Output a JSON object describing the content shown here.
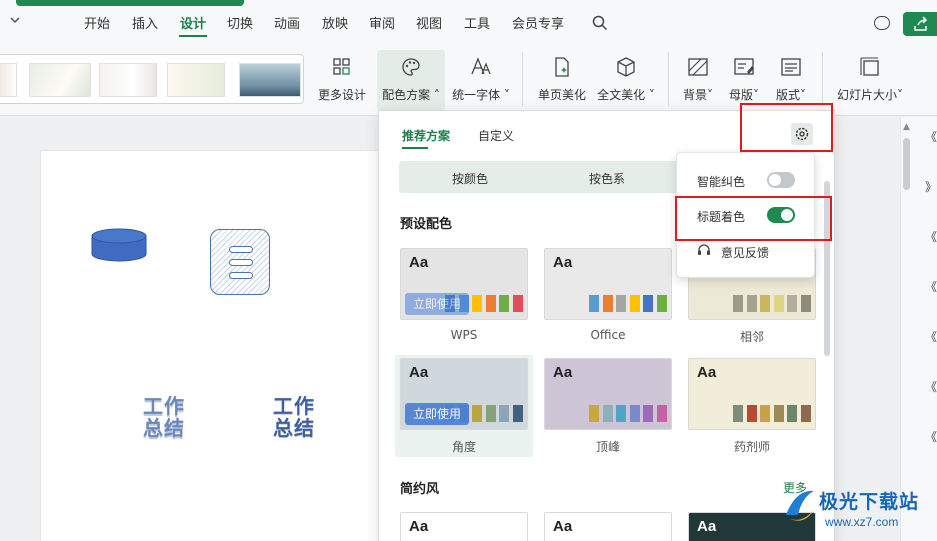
{
  "menu": {
    "tabs": [
      "开始",
      "插入",
      "设计",
      "切换",
      "动画",
      "放映",
      "审阅",
      "视图",
      "工具",
      "会员专享"
    ],
    "active": "设计"
  },
  "ribbon": {
    "more_design": "更多设计",
    "color_scheme": "配色方案",
    "unify_font": "统一字体",
    "page_beautify": "单页美化",
    "full_beautify": "全文美化",
    "background": "背景",
    "master": "母版",
    "layout": "版式",
    "slide_size": "幻灯片大小"
  },
  "slide": {
    "wordart1": "工作总结",
    "wordart2": "工作总结"
  },
  "panel": {
    "tab_recommended": "推荐方案",
    "tab_custom": "自定义",
    "seg_by_color": "按颜色",
    "seg_by_series": "按色系",
    "preset_title": "预设配色",
    "simple_title": "简约风",
    "more": "更多",
    "use_now": "立即使用",
    "aa": "Aa",
    "cards": [
      {
        "name": "WPS",
        "bg": "#e4e4e4",
        "colors": [
          "#4472c4",
          "#5b9bd5",
          "#ffc000",
          "#ed7d31",
          "#70ad47",
          "#e84c5a"
        ]
      },
      {
        "name": "Office",
        "bg": "#e9e9e9",
        "colors": [
          "#5b9bd5",
          "#ed7d31",
          "#a5a5a5",
          "#ffc000",
          "#4472c4",
          "#70ad47"
        ]
      },
      {
        "name": "相邻",
        "bg": "#ece9d6",
        "colors": [
          "#9c9a88",
          "#a6a38a",
          "#c9b660",
          "#dcd585",
          "#b4ae9c",
          "#8e8b79"
        ]
      },
      {
        "name": "角度",
        "bg": "#cfd8dc",
        "colors": [
          "#7e97b3",
          "#6f8aa6",
          "#b6a63c",
          "#87a27a",
          "#8da3b6",
          "#43617e"
        ]
      },
      {
        "name": "顶峰",
        "bg": "#cdc4d6",
        "colors": [
          "#c9a83b",
          "#8eb0b8",
          "#4fa4c8",
          "#7a89c8",
          "#9c6bb6",
          "#c264a4"
        ]
      },
      {
        "name": "药剂师",
        "bg": "#f1edd8",
        "colors": [
          "#7d8c7b",
          "#b64a35",
          "#c7a246",
          "#9a8b57",
          "#6e8668",
          "#8b6a4d"
        ]
      }
    ],
    "bottom_cards": [
      {
        "bg": "#ffffff"
      },
      {
        "bg": "#ffffff"
      },
      {
        "bg": "#203838"
      }
    ]
  },
  "popup": {
    "smart_correct": "智能纠色",
    "title_color": "标题着色",
    "feedback": "意见反馈",
    "smart_correct_on": false,
    "title_color_on": true
  },
  "watermark": {
    "brand": "极光下载站",
    "url": "www.xz7.com"
  },
  "right_rail_chars": [
    "《",
    "》",
    "《",
    "《",
    "《",
    "《",
    "《"
  ]
}
